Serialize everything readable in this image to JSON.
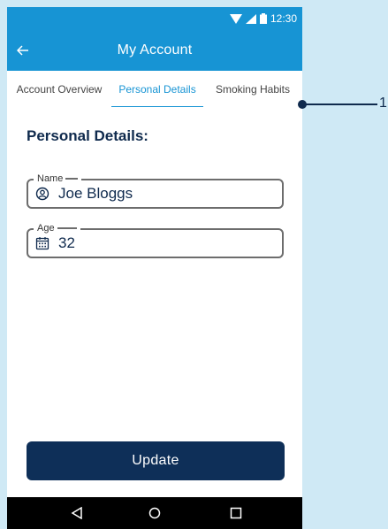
{
  "status_bar": {
    "time": "12:30"
  },
  "app_bar": {
    "title": "My Account"
  },
  "tabs": [
    {
      "label": "Account Overview",
      "active": false
    },
    {
      "label": "Personal Details",
      "active": true
    },
    {
      "label": "Smoking Habits",
      "active": false
    }
  ],
  "section_title": "Personal Details:",
  "fields": {
    "name": {
      "label": "Name",
      "value": "Joe Bloggs",
      "icon": "user-circle-icon"
    },
    "age": {
      "label": "Age",
      "value": "32",
      "icon": "calendar-icon"
    }
  },
  "update_button": {
    "label": "Update"
  },
  "callout": {
    "number": "1"
  },
  "colors": {
    "primary": "#1794d4",
    "navy": "#0f2a4d",
    "button": "#0e2f58",
    "background": "#cfe9f5"
  }
}
